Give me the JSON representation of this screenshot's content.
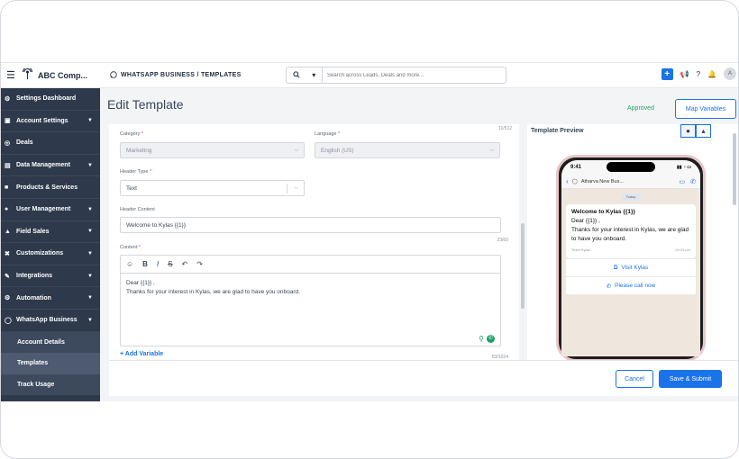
{
  "app": {
    "company": "ABC Comp...",
    "breadcrumb": "WHATSAPP BUSINESS / TEMPLATES",
    "search_placeholder": "Search across Leads, Deals and more...",
    "search_icon": "search-icon",
    "avatar_initials": "A"
  },
  "sidebar": {
    "items": [
      {
        "label": "Settings Dashboard",
        "icon": "gear-icon",
        "has_caret": false
      },
      {
        "label": "Account Settings",
        "icon": "account-icon",
        "has_caret": true
      },
      {
        "label": "Deals",
        "icon": "deals-icon",
        "has_caret": false
      },
      {
        "label": "Data Management",
        "icon": "database-icon",
        "has_caret": true
      },
      {
        "label": "Products & Services",
        "icon": "box-icon",
        "has_caret": false
      },
      {
        "label": "User Management",
        "icon": "users-icon",
        "has_caret": true
      },
      {
        "label": "Field Sales",
        "icon": "field-sales-icon",
        "has_caret": true
      },
      {
        "label": "Customizations",
        "icon": "tools-icon",
        "has_caret": true
      },
      {
        "label": "Integrations",
        "icon": "integrations-icon",
        "has_caret": true
      },
      {
        "label": "Automation",
        "icon": "automation-icon",
        "has_caret": true
      },
      {
        "label": "WhatsApp Business",
        "icon": "whatsapp-icon",
        "has_caret": true
      }
    ],
    "sub_items": [
      {
        "label": "Account Details"
      },
      {
        "label": "Templates"
      },
      {
        "label": "Track Usage"
      }
    ]
  },
  "page": {
    "title": "Edit Template",
    "status": "Approved",
    "map_variables": "Map Variables"
  },
  "form": {
    "top_counter": "11/512",
    "category_label": "Category",
    "category_value": "Marketing",
    "language_label": "Language",
    "language_value": "English (US)",
    "header_type_label": "Header Type",
    "header_type_value": "Text",
    "header_content_label": "Header Content",
    "header_content_value": "Welcome to Kylas {{1}}",
    "header_counter": "23/60",
    "content_label": "Content",
    "content_line1": "Dear {{1}} ,",
    "content_line2": "Thanks for your interest in Kylas, we are glad to have you onboard.",
    "content_counter": "83/1024",
    "add_variable": "+ Add Variable",
    "required_mark": "*",
    "toolbar": {
      "bold": "B",
      "italic": "I",
      "strike": "S",
      "undo": "↶",
      "redo": "↷"
    }
  },
  "preview": {
    "title": "Template Preview",
    "os_ios": "",
    "os_android": "",
    "time": "9:41",
    "contact": "Atharva New Bus...",
    "today": "Today",
    "bubble_header": "Welcome to Kylas {{1}}",
    "bubble_line1": "Dear {{1}} ,",
    "bubble_line2": "Thanks for your interest in Kylas, we are glad to have you onboard.",
    "bubble_footer": "Team Kylas",
    "bubble_time": "04:23 pm",
    "cta1": "Visit Kylas",
    "cta2": "Please call now"
  },
  "footer": {
    "cancel": "Cancel",
    "submit": "Save & Submit"
  }
}
